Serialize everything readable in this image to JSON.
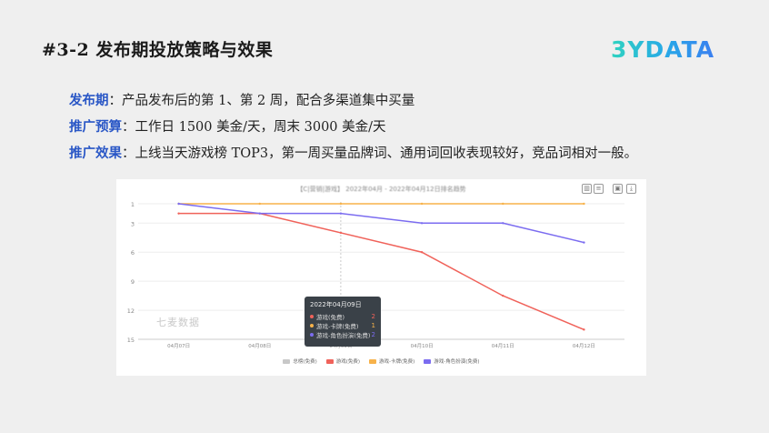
{
  "slide": {
    "title": "#3-2 发布期投放策略与效果",
    "logo": "3YDATA"
  },
  "bullets": [
    {
      "key": "发布期",
      "text": "：产品发布后的第 1、第 2 周，配合多渠道集中买量"
    },
    {
      "key": "推广预算",
      "text": "：工作日 1500 美金/天，周末 3000 美金/天"
    },
    {
      "key": "推广效果",
      "text": "：上线当天游戏榜 TOP3，第一周买量品牌词、通用词回收表现较好，竞品词相对一般。"
    }
  ],
  "chart": {
    "title": "【C|营销|游戏】 2022年04月 - 2022年04月12日排名趋势",
    "watermark": "七麦数据",
    "tooltip": {
      "header": "2022年04月09日",
      "rows": [
        {
          "name": "游戏(免费)",
          "value": "2",
          "color": "#f0625a"
        },
        {
          "name": "游戏-卡牌(免费)",
          "value": "1",
          "color": "#f7b24a"
        },
        {
          "name": "游戏-角色扮演(免费)",
          "value": "2",
          "color": "#7b6cf0"
        }
      ]
    }
  },
  "chart_data": {
    "type": "line",
    "title": "【C|营销|游戏】 2022年04月 - 2022年04月12日排名趋势",
    "x": [
      "04月07日",
      "04月08日",
      "04月09日",
      "04月10日",
      "04月11日",
      "04月12日"
    ],
    "y_ticks": [
      1,
      3,
      6,
      9,
      12,
      15
    ],
    "ylim": [
      1,
      15
    ],
    "y_inverted": true,
    "legend_position": "bottom",
    "series": [
      {
        "name": "总榜(免费)",
        "color": "#c8c8c8",
        "values": [
          null,
          null,
          null,
          null,
          null,
          null
        ]
      },
      {
        "name": "游戏(免费)",
        "color": "#f0625a",
        "values": [
          2,
          2,
          4,
          6,
          10.5,
          14
        ]
      },
      {
        "name": "游戏-卡牌(免费)",
        "color": "#f7b24a",
        "values": [
          1,
          1,
          1,
          1,
          1,
          1
        ]
      },
      {
        "name": "游戏-角色扮演(免费)",
        "color": "#7b6cf0",
        "values": [
          1,
          2,
          2,
          3,
          3,
          5
        ]
      }
    ]
  }
}
